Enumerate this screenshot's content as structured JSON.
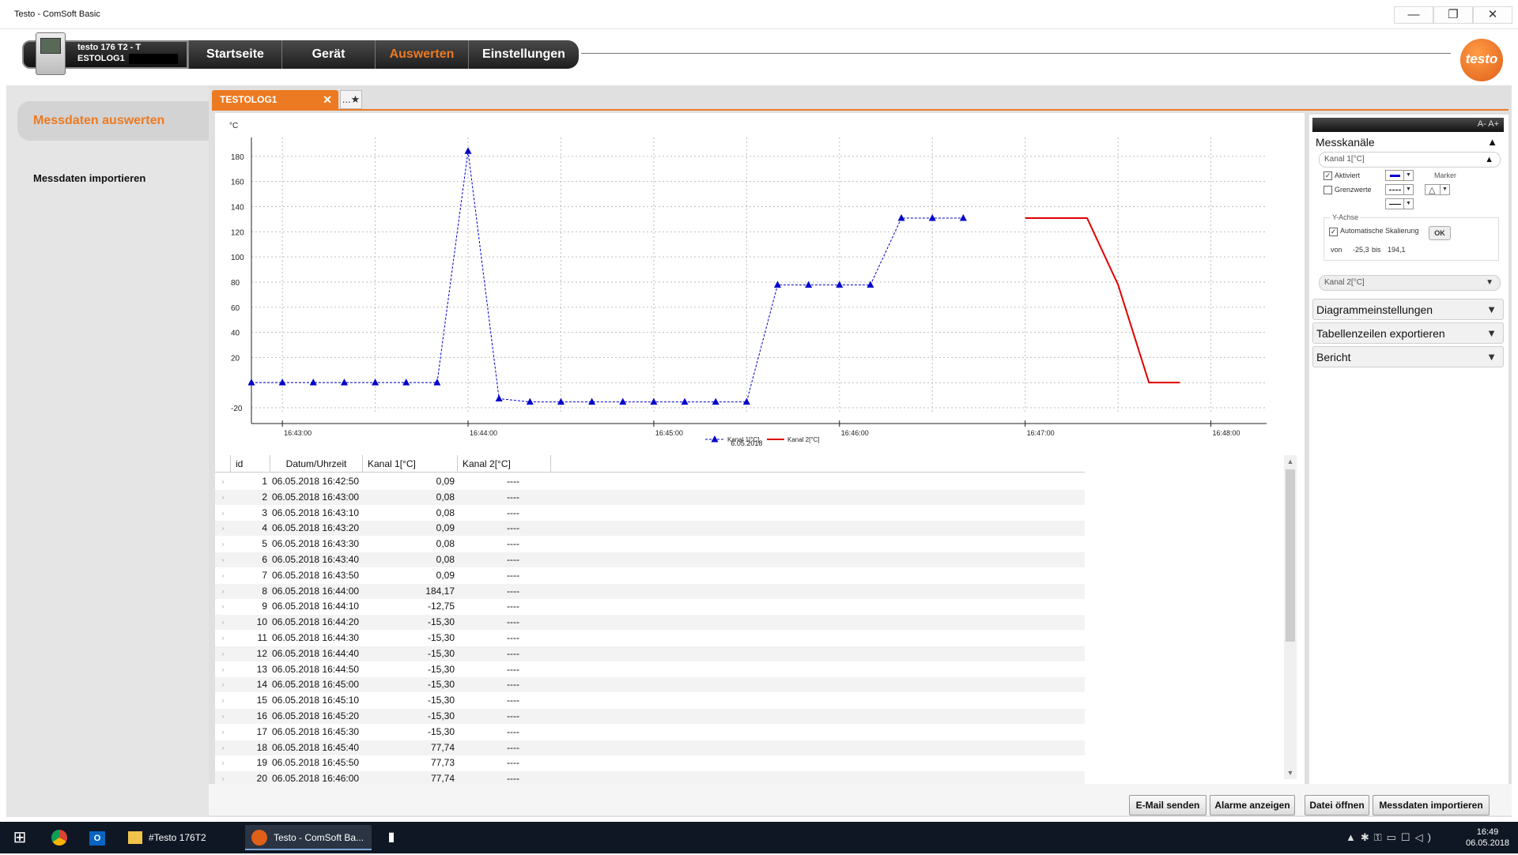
{
  "window": {
    "title": "Testo - ComSoft Basic",
    "minimize_glyph": "—",
    "maximize_glyph": "❐",
    "close_glyph": "✕"
  },
  "device": {
    "name_line1": "testo 176 T2 - T",
    "name_line2": "ESTOLOG1"
  },
  "nav": {
    "tabs": [
      {
        "label": "Startseite",
        "active": false
      },
      {
        "label": "Gerät",
        "active": false
      },
      {
        "label": "Auswerten",
        "active": true
      },
      {
        "label": "Einstellungen",
        "active": false
      }
    ]
  },
  "logo": {
    "text": "testo"
  },
  "left_panel": {
    "items": [
      {
        "label": "Messdaten auswerten",
        "selected": true
      },
      {
        "label": "Messdaten importieren",
        "selected": false
      }
    ]
  },
  "doc_tab": {
    "label": "TESTOLOG1",
    "close_glyph": "✕",
    "new_tab_glyph": "...★"
  },
  "colors": {
    "accent": "#ec7a22",
    "kanal1": "#0000cc",
    "kanal2": "#e00000"
  },
  "chart_data": {
    "type": "line",
    "ylabel": "°C",
    "ylim": [
      -25,
      195
    ],
    "yticks": [
      -20,
      20,
      40,
      60,
      80,
      100,
      120,
      140,
      160,
      180
    ],
    "xticks": [
      "16:43:00",
      "16:44:00",
      "16:45:00",
      "16:46:00",
      "16:47:00",
      "16:48:00"
    ],
    "xtick_seconds": [
      60,
      120,
      180,
      240,
      300,
      360
    ],
    "date_label": "6.05.2018",
    "grid": true,
    "legend": "bottom-center",
    "series": [
      {
        "name": "Kanal 1[°C]",
        "marker": "triangle",
        "x_seconds": [
          50,
          60,
          70,
          80,
          90,
          100,
          110,
          120,
          130,
          140,
          150,
          160,
          170,
          180,
          190,
          200,
          210,
          220,
          230,
          240,
          250,
          260,
          270,
          280,
          290,
          300
        ],
        "values": [
          0.09,
          0.08,
          0.08,
          0.09,
          0.08,
          0.08,
          0.09,
          184.17,
          -12.75,
          -15.3,
          -15.3,
          -15.3,
          -15.3,
          -15.3,
          -15.3,
          -15.3,
          -15.3,
          77.74,
          77.73,
          77.74,
          77.74,
          130.9,
          130.9,
          130.9,
          null,
          null
        ]
      },
      {
        "name": "Kanal 2[°C]",
        "marker": "none",
        "x_seconds": [
          300,
          310,
          320,
          330,
          340,
          350
        ],
        "values": [
          130.9,
          130.9,
          130.9,
          78,
          0.09,
          0.09
        ]
      }
    ]
  },
  "table": {
    "columns": [
      "id",
      "Datum/Uhrzeit",
      "Kanal 1[°C]",
      "Kanal 2[°C]"
    ],
    "row_marker": "›",
    "rows": [
      [
        "1",
        "06.05.2018 16:42:50",
        "0,09",
        "----"
      ],
      [
        "2",
        "06.05.2018 16:43:00",
        "0,08",
        "----"
      ],
      [
        "3",
        "06.05.2018 16:43:10",
        "0,08",
        "----"
      ],
      [
        "4",
        "06.05.2018 16:43:20",
        "0,09",
        "----"
      ],
      [
        "5",
        "06.05.2018 16:43:30",
        "0,08",
        "----"
      ],
      [
        "6",
        "06.05.2018 16:43:40",
        "0,08",
        "----"
      ],
      [
        "7",
        "06.05.2018 16:43:50",
        "0,09",
        "----"
      ],
      [
        "8",
        "06.05.2018 16:44:00",
        "184,17",
        "----"
      ],
      [
        "9",
        "06.05.2018 16:44:10",
        "-12,75",
        "----"
      ],
      [
        "10",
        "06.05.2018 16:44:20",
        "-15,30",
        "----"
      ],
      [
        "11",
        "06.05.2018 16:44:30",
        "-15,30",
        "----"
      ],
      [
        "12",
        "06.05.2018 16:44:40",
        "-15,30",
        "----"
      ],
      [
        "13",
        "06.05.2018 16:44:50",
        "-15,30",
        "----"
      ],
      [
        "14",
        "06.05.2018 16:45:00",
        "-15,30",
        "----"
      ],
      [
        "15",
        "06.05.2018 16:45:10",
        "-15,30",
        "----"
      ],
      [
        "16",
        "06.05.2018 16:45:20",
        "-15,30",
        "----"
      ],
      [
        "17",
        "06.05.2018 16:45:30",
        "-15,30",
        "----"
      ],
      [
        "18",
        "06.05.2018 16:45:40",
        "77,74",
        "----"
      ],
      [
        "19",
        "06.05.2018 16:45:50",
        "77,73",
        "----"
      ],
      [
        "20",
        "06.05.2018 16:46:00",
        "77,74",
        "----"
      ]
    ]
  },
  "side_panel": {
    "font_size_label": "A- A+",
    "messkanaele": "Messkanäle",
    "kanal1": "Kanal 1[°C]",
    "aktiviert": "Aktiviert",
    "grenzwerte": "Grenzwerte",
    "marker": "Marker",
    "marker_symbol": "△",
    "y_achse": "Y-Achse",
    "auto_skalierung": "Automatische Skalierung",
    "ok": "OK",
    "von_label": "von",
    "von_value": "-25,3",
    "bis_label": "bis",
    "bis_value": "194,1",
    "kanal2": "Kanal 2[°C]",
    "diagramm": "Diagrammeinstellungen",
    "tabellen": "Tabellenzeilen exportieren",
    "bericht": "Bericht"
  },
  "buttons": {
    "email": "E-Mail senden",
    "alarme": "Alarme anzeigen",
    "datei": "Datei öffnen",
    "import": "Messdaten importieren"
  },
  "taskbar": {
    "items": [
      "#Testo 176T2",
      "Testo - ComSoft Ba..."
    ],
    "time": "16:49",
    "date": "06.05.2018"
  }
}
